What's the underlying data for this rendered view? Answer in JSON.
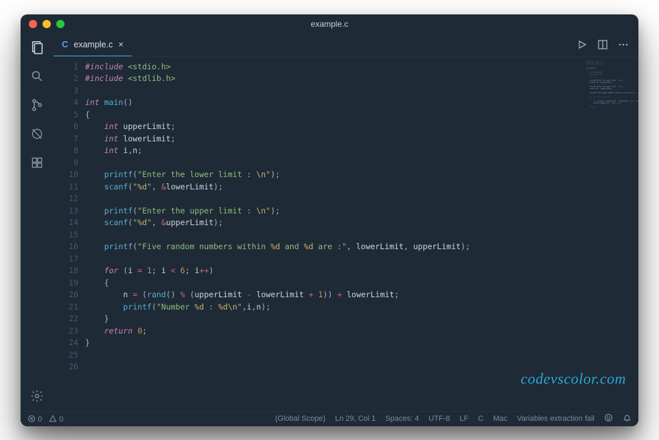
{
  "title": "example.c",
  "tab": {
    "label": "example.c",
    "lang_badge": "C"
  },
  "watermark": "codevscolor.com",
  "code_lines": [
    [
      [
        "pp",
        "#include"
      ],
      [
        "sp",
        " "
      ],
      [
        "inc",
        "<stdio.h>"
      ]
    ],
    [
      [
        "pp",
        "#include"
      ],
      [
        "sp",
        " "
      ],
      [
        "inc",
        "<stdlib.h>"
      ]
    ],
    [],
    [
      [
        "kw",
        "int"
      ],
      [
        "sp",
        " "
      ],
      [
        "fn",
        "main"
      ],
      [
        "pun",
        "()"
      ]
    ],
    [
      [
        "pun",
        "{"
      ]
    ],
    [
      [
        "sp",
        "    "
      ],
      [
        "kw",
        "int"
      ],
      [
        "sp",
        " "
      ],
      [
        "id",
        "upperLimit"
      ],
      [
        "pun",
        ";"
      ]
    ],
    [
      [
        "sp",
        "    "
      ],
      [
        "kw",
        "int"
      ],
      [
        "sp",
        " "
      ],
      [
        "id",
        "lowerLimit"
      ],
      [
        "pun",
        ";"
      ]
    ],
    [
      [
        "sp",
        "    "
      ],
      [
        "kw",
        "int"
      ],
      [
        "sp",
        " "
      ],
      [
        "id",
        "i"
      ],
      [
        "pun",
        ","
      ],
      [
        "id",
        "n"
      ],
      [
        "pun",
        ";"
      ]
    ],
    [],
    [
      [
        "sp",
        "    "
      ],
      [
        "fn",
        "printf"
      ],
      [
        "pun",
        "("
      ],
      [
        "str",
        "\"Enter the lower limit : "
      ],
      [
        "esc",
        "\\n"
      ],
      [
        "str",
        "\""
      ],
      [
        "pun",
        ");"
      ]
    ],
    [
      [
        "sp",
        "    "
      ],
      [
        "fn",
        "scanf"
      ],
      [
        "pun",
        "("
      ],
      [
        "str",
        "\""
      ],
      [
        "esc",
        "%d"
      ],
      [
        "str",
        "\""
      ],
      [
        "pun",
        ", "
      ],
      [
        "op",
        "&"
      ],
      [
        "id",
        "lowerLimit"
      ],
      [
        "pun",
        ");"
      ]
    ],
    [],
    [
      [
        "sp",
        "    "
      ],
      [
        "fn",
        "printf"
      ],
      [
        "pun",
        "("
      ],
      [
        "str",
        "\"Enter the upper limit : "
      ],
      [
        "esc",
        "\\n"
      ],
      [
        "str",
        "\""
      ],
      [
        "pun",
        ");"
      ]
    ],
    [
      [
        "sp",
        "    "
      ],
      [
        "fn",
        "scanf"
      ],
      [
        "pun",
        "("
      ],
      [
        "str",
        "\""
      ],
      [
        "esc",
        "%d"
      ],
      [
        "str",
        "\""
      ],
      [
        "pun",
        ", "
      ],
      [
        "op",
        "&"
      ],
      [
        "id",
        "upperLimit"
      ],
      [
        "pun",
        ");"
      ]
    ],
    [],
    [
      [
        "sp",
        "    "
      ],
      [
        "fn",
        "printf"
      ],
      [
        "pun",
        "("
      ],
      [
        "str",
        "\"Five random numbers within "
      ],
      [
        "esc",
        "%d"
      ],
      [
        "str",
        " and "
      ],
      [
        "esc",
        "%d"
      ],
      [
        "str",
        " are :\""
      ],
      [
        "pun",
        ", "
      ],
      [
        "id",
        "lowerLimit"
      ],
      [
        "pun",
        ", "
      ],
      [
        "id",
        "upperLimit"
      ],
      [
        "pun",
        ");"
      ]
    ],
    [],
    [
      [
        "sp",
        "    "
      ],
      [
        "kw",
        "for"
      ],
      [
        "sp",
        " "
      ],
      [
        "pun",
        "("
      ],
      [
        "id",
        "i"
      ],
      [
        "sp",
        " "
      ],
      [
        "op",
        "="
      ],
      [
        "sp",
        " "
      ],
      [
        "num",
        "1"
      ],
      [
        "pun",
        "; "
      ],
      [
        "id",
        "i"
      ],
      [
        "sp",
        " "
      ],
      [
        "op",
        "<"
      ],
      [
        "sp",
        " "
      ],
      [
        "num",
        "6"
      ],
      [
        "pun",
        "; "
      ],
      [
        "id",
        "i"
      ],
      [
        "op",
        "++"
      ],
      [
        "pun",
        ")"
      ]
    ],
    [
      [
        "sp",
        "    "
      ],
      [
        "pun",
        "{"
      ]
    ],
    [
      [
        "sp",
        "        "
      ],
      [
        "id",
        "n"
      ],
      [
        "sp",
        " "
      ],
      [
        "op",
        "="
      ],
      [
        "sp",
        " "
      ],
      [
        "pun",
        "("
      ],
      [
        "fn",
        "rand"
      ],
      [
        "pun",
        "() "
      ],
      [
        "op",
        "%"
      ],
      [
        "sp",
        " "
      ],
      [
        "pun",
        "("
      ],
      [
        "id",
        "upperLimit"
      ],
      [
        "sp",
        " "
      ],
      [
        "op",
        "-"
      ],
      [
        "sp",
        " "
      ],
      [
        "id",
        "lowerLimit"
      ],
      [
        "sp",
        " "
      ],
      [
        "op",
        "+"
      ],
      [
        "sp",
        " "
      ],
      [
        "num",
        "1"
      ],
      [
        "pun",
        "))"
      ],
      [
        "sp",
        " "
      ],
      [
        "op",
        "+"
      ],
      [
        "sp",
        " "
      ],
      [
        "id",
        "lowerLimit"
      ],
      [
        "pun",
        ";"
      ]
    ],
    [
      [
        "sp",
        "        "
      ],
      [
        "fn",
        "printf"
      ],
      [
        "pun",
        "("
      ],
      [
        "str",
        "\"Number "
      ],
      [
        "esc",
        "%d"
      ],
      [
        "str",
        " : "
      ],
      [
        "esc",
        "%d"
      ],
      [
        "esc",
        "\\n"
      ],
      [
        "str",
        "\""
      ],
      [
        "pun",
        ","
      ],
      [
        "id",
        "i"
      ],
      [
        "pun",
        ","
      ],
      [
        "id",
        "n"
      ],
      [
        "pun",
        ");"
      ]
    ],
    [
      [
        "sp",
        "    "
      ],
      [
        "pun",
        "}"
      ]
    ],
    [
      [
        "sp",
        "    "
      ],
      [
        "kw",
        "return"
      ],
      [
        "sp",
        " "
      ],
      [
        "num",
        "0"
      ],
      [
        "pun",
        ";"
      ]
    ],
    [
      [
        "pun",
        "}"
      ]
    ],
    [],
    []
  ],
  "status": {
    "errors": "0",
    "warnings": "0",
    "scope": "(Global Scope)",
    "cursor": "Ln 29, Col 1",
    "spaces": "Spaces: 4",
    "encoding": "UTF-8",
    "eol": "LF",
    "language": "C",
    "os": "Mac",
    "msg": "Variables extraction fail"
  }
}
